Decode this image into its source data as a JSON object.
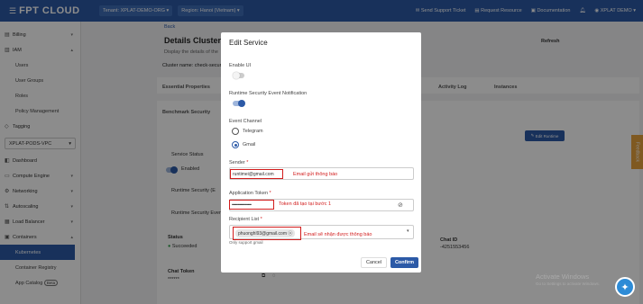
{
  "topbar": {
    "brand": "FPT CLOUD",
    "tenant": "Tenant: XPLAT-DEMO-ORG",
    "region": "Region: Hanoi (Vietnam)",
    "support": "Send Support Ticket",
    "request": "Request Resource",
    "docs": "Documentation",
    "user": "XPLAT DEMO"
  },
  "sidebar": {
    "items": [
      {
        "label": "Billing",
        "icon": "billing-icon"
      },
      {
        "label": "IAM",
        "icon": "iam-icon"
      }
    ],
    "iam_sub": [
      "Users",
      "User Groups",
      "Roles",
      "Policy Management"
    ],
    "tagging": "Tagging",
    "vpc": "XPLAT-PODS-VPC",
    "nav": [
      "Dashboard",
      "Compute Engine",
      "Networking",
      "Autoscaling",
      "Load Balancer",
      "Containers"
    ],
    "containers_sub": [
      "Kubernetes",
      "Container Registry",
      "App Catalog"
    ],
    "app_catalog_badge": "Beta"
  },
  "page": {
    "back": "Back",
    "title": "Details Cluster -",
    "subtitle": "Display the details of the",
    "cluster_name": "Cluster name: check-securi",
    "refresh": "Refresh",
    "tabs": [
      "Essential Properties",
      "Activity Log",
      "Instances"
    ],
    "subtab": "Benchmark Security",
    "edit_runtime": "Edit Runtime",
    "service_status_label": "Service Status",
    "service_status": "Enabled",
    "runtime_security_1": "Runtime Security (E",
    "runtime_security_2": "Runtime Security Event",
    "status_label": "Status",
    "status_value": "Succeeded",
    "chat_id_label": "Chat ID",
    "chat_id": "-4251553456",
    "chat_token_label": "Chat Token",
    "chat_token": "******"
  },
  "modal": {
    "title": "Edit Service",
    "enable_ui": "Enable UI",
    "runtime_notification": "Runtime Security Event Notification",
    "event_channel": "Event Channel",
    "telegram": "Telegram",
    "gmail": "Gmail",
    "sender_label": "Sender",
    "sender_value": "runtimei@gmail.com",
    "sender_note": "Email gửi thông báo",
    "token_label": "Application Token",
    "token_value": "••••••••••••••••••••",
    "token_note": "Token đã tạo tại bước 1",
    "recipient_label": "Recipient List",
    "recipient_chip": "phuonghl93@gmail.com",
    "recipient_note": "Email sẽ nhận được thông báo",
    "recipient_help": "Only support gmail",
    "required_mark": "*",
    "cancel": "Cancel",
    "confirm": "Confirm"
  },
  "floating": {
    "feedback": "Feedback",
    "watermark_1": "Activate Windows",
    "watermark_2": "Go to Settings to activate Windows."
  },
  "colors": {
    "primary": "#2c5aa7",
    "annotation": "#d21c1c",
    "success": "#2e9e48"
  }
}
